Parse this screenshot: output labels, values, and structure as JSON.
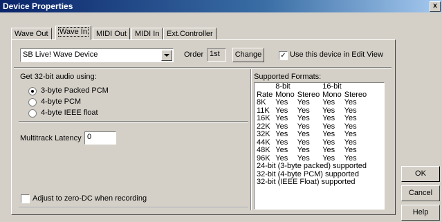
{
  "window": {
    "title": "Device Properties",
    "close_label": "x"
  },
  "tabs": [
    "Wave Out",
    "Wave In",
    "MIDI Out",
    "MIDI In",
    "Ext.Controller"
  ],
  "active_tab": "Wave In",
  "device": {
    "selected": "SB Live! Wave Device"
  },
  "order": {
    "label": "Order",
    "value": "1st",
    "change_label": "Change"
  },
  "use_in_edit_view": {
    "label": "Use this device in Edit View",
    "checked": true
  },
  "get32": {
    "label": "Get 32-bit audio using:",
    "options": [
      "3-byte Packed PCM",
      "4-byte PCM",
      "4-byte IEEE float"
    ],
    "selected": "3-byte Packed PCM"
  },
  "latency": {
    "label": "Multitrack Latency",
    "value": "0"
  },
  "zero_dc": {
    "label": "Adjust to zero-DC when recording",
    "checked": false
  },
  "formats": {
    "label": "Supported Formats:",
    "group_headers": [
      "8-bit",
      "16-bit"
    ],
    "col_headers": [
      "Rate",
      "Mono",
      "Stereo",
      "Mono",
      "Stereo"
    ],
    "rows": [
      [
        "8K",
        "Yes",
        "Yes",
        "Yes",
        "Yes"
      ],
      [
        "11K",
        "Yes",
        "Yes",
        "Yes",
        "Yes"
      ],
      [
        "16K",
        "Yes",
        "Yes",
        "Yes",
        "Yes"
      ],
      [
        "22K",
        "Yes",
        "Yes",
        "Yes",
        "Yes"
      ],
      [
        "32K",
        "Yes",
        "Yes",
        "Yes",
        "Yes"
      ],
      [
        "44K",
        "Yes",
        "Yes",
        "Yes",
        "Yes"
      ],
      [
        "48K",
        "Yes",
        "Yes",
        "Yes",
        "Yes"
      ],
      [
        "96K",
        "Yes",
        "Yes",
        "Yes",
        "Yes"
      ]
    ],
    "notes": [
      "24-bit (3-byte packed) supported",
      "32-bit (4-byte PCM) supported",
      "32-bit (IEEE Float) supported"
    ]
  },
  "buttons": {
    "ok": "OK",
    "cancel": "Cancel",
    "help": "Help"
  }
}
